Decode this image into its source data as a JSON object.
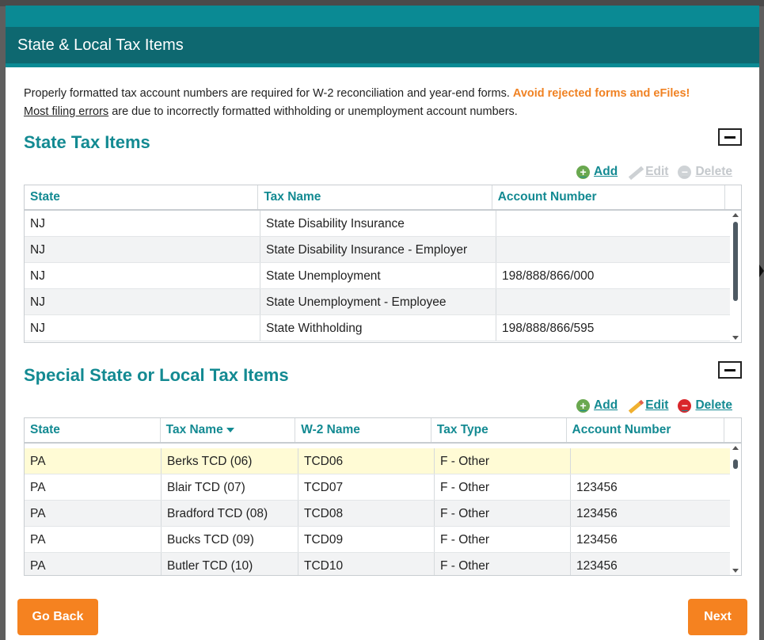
{
  "dialog": {
    "title": "State & Local Tax Items",
    "intro": {
      "text1": "Properly formatted tax account numbers are required for W-2 reconciliation and year-end forms. ",
      "warning": "Avoid rejected forms and eFiles!",
      "link": "Most filing errors",
      "text2": " are due to incorrectly formatted withholding or unemployment account numbers."
    }
  },
  "state_section": {
    "title": "State Tax Items",
    "actions": {
      "add": "Add",
      "edit": "Edit",
      "delete": "Delete"
    },
    "columns": [
      "State",
      "Tax Name",
      "Account Number"
    ],
    "rows": [
      {
        "state": "NJ",
        "tax_name": "State Disability Insurance",
        "account": ""
      },
      {
        "state": "NJ",
        "tax_name": "State Disability Insurance - Employer",
        "account": ""
      },
      {
        "state": "NJ",
        "tax_name": "State Unemployment",
        "account": "198/888/866/000"
      },
      {
        "state": "NJ",
        "tax_name": "State Unemployment - Employee",
        "account": ""
      },
      {
        "state": "NJ",
        "tax_name": "State Withholding",
        "account": "198/888/866/595"
      }
    ]
  },
  "special_section": {
    "title": "Special State or Local Tax Items",
    "actions": {
      "add": "Add",
      "edit": "Edit",
      "delete": "Delete"
    },
    "columns": [
      "State",
      "Tax Name",
      "W-2 Name",
      "Tax Type",
      "Account Number"
    ],
    "rows": [
      {
        "state": "PA",
        "tax_name": "Berks TCD (06)",
        "w2": "TCD06",
        "type": "F - Other",
        "account": ""
      },
      {
        "state": "PA",
        "tax_name": "Blair TCD (07)",
        "w2": "TCD07",
        "type": "F - Other",
        "account": "123456"
      },
      {
        "state": "PA",
        "tax_name": "Bradford TCD (08)",
        "w2": "TCD08",
        "type": "F - Other",
        "account": "123456"
      },
      {
        "state": "PA",
        "tax_name": "Bucks TCD (09)",
        "w2": "TCD09",
        "type": "F - Other",
        "account": "123456"
      },
      {
        "state": "PA",
        "tax_name": "Butler TCD (10)",
        "w2": "TCD10",
        "type": "F - Other",
        "account": "123456"
      }
    ]
  },
  "footer": {
    "back": "Go Back",
    "next": "Next"
  },
  "colors": {
    "teal": "#138a92",
    "header": "#0e6870",
    "orange": "#f58220"
  }
}
